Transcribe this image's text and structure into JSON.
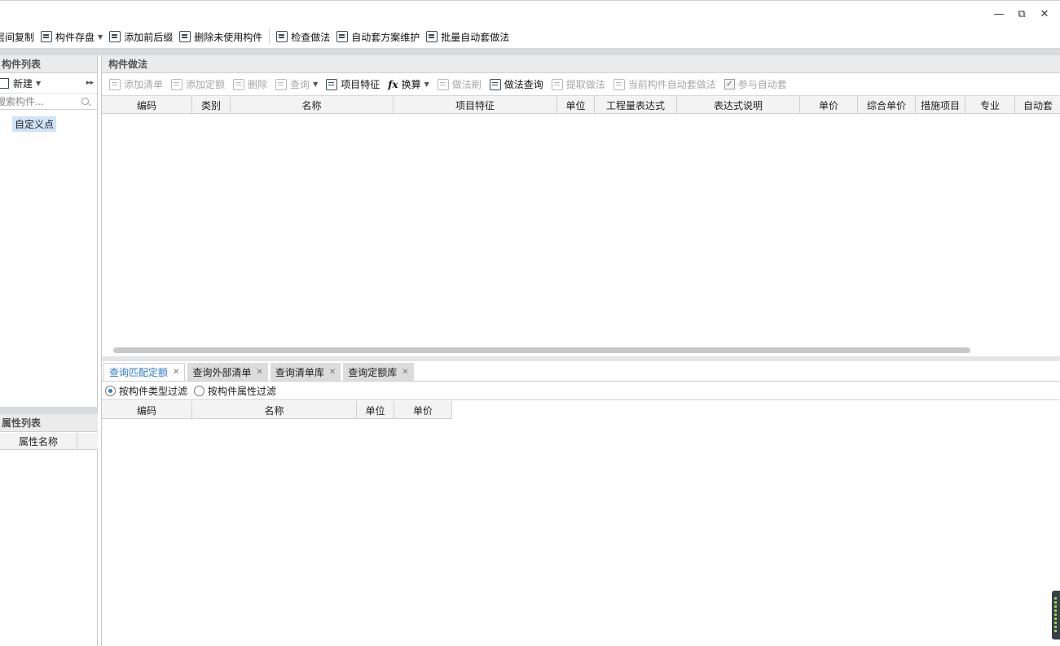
{
  "window": {
    "minimize": "—",
    "restore": "⧉",
    "close": "✕"
  },
  "toolbar": {
    "items": [
      {
        "label": "层间复制"
      },
      {
        "label": "构件存盘",
        "dropdown": true
      },
      {
        "label": "添加前后缀"
      },
      {
        "label": "删除未使用构件"
      },
      {
        "label": "检查做法"
      },
      {
        "label": "自动套方案维护"
      },
      {
        "label": "批量自动套做法"
      }
    ]
  },
  "left_panel": {
    "title": "构件列表",
    "new_label": "新建",
    "search_placeholder": "搜索构件...",
    "tree_item": "自定义点",
    "attr_title": "属性列表",
    "attr_columns": [
      "属性名称",
      ""
    ]
  },
  "right_panel": {
    "title": "构件做法",
    "tools": [
      {
        "label": "添加清单",
        "enabled": false
      },
      {
        "label": "添加定额",
        "enabled": false
      },
      {
        "label": "删除",
        "enabled": false
      },
      {
        "label": "查询",
        "enabled": false,
        "dropdown": true
      },
      {
        "label": "项目特征",
        "enabled": true
      },
      {
        "label": "换算",
        "enabled": true,
        "dropdown": true,
        "icon": "fx"
      },
      {
        "label": "做法刷",
        "enabled": false
      },
      {
        "label": "做法查询",
        "enabled": true
      },
      {
        "label": "提取做法",
        "enabled": false
      },
      {
        "label": "当前构件自动套做法",
        "enabled": false
      },
      {
        "label": "参与自动套",
        "enabled": false,
        "checkbox": true,
        "checked": true
      }
    ],
    "columns": [
      "编码",
      "类别",
      "名称",
      "项目特征",
      "单位",
      "工程量表达式",
      "表达式说明",
      "单价",
      "综合单价",
      "措施项目",
      "专业",
      "自动套"
    ]
  },
  "bottom_panel": {
    "tabs": [
      {
        "label": "查询匹配定额",
        "active": true
      },
      {
        "label": "查询外部清单",
        "active": false
      },
      {
        "label": "查询清单库",
        "active": false
      },
      {
        "label": "查询定额库",
        "active": false
      }
    ],
    "filters": [
      {
        "label": "按构件类型过滤",
        "selected": true
      },
      {
        "label": "按构件属性过滤",
        "selected": false
      }
    ],
    "columns": [
      "编码",
      "名称",
      "单位",
      "单价"
    ]
  }
}
